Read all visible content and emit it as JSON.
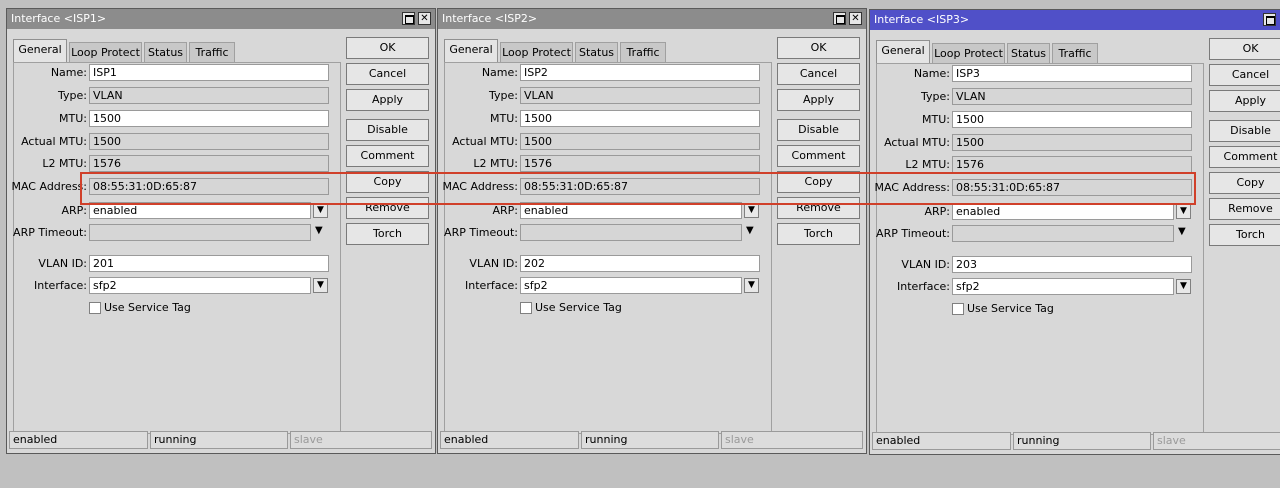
{
  "windows": [
    {
      "title": "Interface <ISP1>",
      "tabs": [
        "General",
        "Loop Protect",
        "Status",
        "Traffic"
      ],
      "labels": {
        "name": "Name:",
        "type": "Type:",
        "mtu": "MTU:",
        "actual_mtu": "Actual MTU:",
        "l2_mtu": "L2 MTU:",
        "mac": "MAC Address:",
        "arp": "ARP:",
        "arp_timeout": "ARP Timeout:",
        "vlan_id": "VLAN ID:",
        "interface": "Interface:"
      },
      "fields": {
        "name": "ISP1",
        "type": "VLAN",
        "mtu": "1500",
        "actual_mtu": "1500",
        "l2_mtu": "1576",
        "mac": "08:55:31:0D:65:87",
        "arp": "enabled",
        "arp_timeout": "",
        "vlan_id": "201",
        "interface": "sfp2"
      },
      "use_service_tag": "Use Service Tag",
      "buttons": [
        "OK",
        "Cancel",
        "Apply",
        "Disable",
        "Comment",
        "Copy",
        "Remove",
        "Torch"
      ],
      "status": [
        "enabled",
        "running",
        "slave"
      ]
    },
    {
      "title": "Interface <ISP2>",
      "tabs": [
        "General",
        "Loop Protect",
        "Status",
        "Traffic"
      ],
      "labels": {
        "name": "Name:",
        "type": "Type:",
        "mtu": "MTU:",
        "actual_mtu": "Actual MTU:",
        "l2_mtu": "L2 MTU:",
        "mac": "MAC Address:",
        "arp": "ARP:",
        "arp_timeout": "ARP Timeout:",
        "vlan_id": "VLAN ID:",
        "interface": "Interface:"
      },
      "fields": {
        "name": "ISP2",
        "type": "VLAN",
        "mtu": "1500",
        "actual_mtu": "1500",
        "l2_mtu": "1576",
        "mac": "08:55:31:0D:65:87",
        "arp": "enabled",
        "arp_timeout": "",
        "vlan_id": "202",
        "interface": "sfp2"
      },
      "use_service_tag": "Use Service Tag",
      "buttons": [
        "OK",
        "Cancel",
        "Apply",
        "Disable",
        "Comment",
        "Copy",
        "Remove",
        "Torch"
      ],
      "status": [
        "enabled",
        "running",
        "slave"
      ]
    },
    {
      "title": "Interface <ISP3>",
      "tabs": [
        "General",
        "Loop Protect",
        "Status",
        "Traffic"
      ],
      "labels": {
        "name": "Name:",
        "type": "Type:",
        "mtu": "MTU:",
        "actual_mtu": "Actual MTU:",
        "l2_mtu": "L2 MTU:",
        "mac": "MAC Address:",
        "arp": "ARP:",
        "arp_timeout": "ARP Timeout:",
        "vlan_id": "VLAN ID:",
        "interface": "Interface:"
      },
      "fields": {
        "name": "ISP3",
        "type": "VLAN",
        "mtu": "1500",
        "actual_mtu": "1500",
        "l2_mtu": "1576",
        "mac": "08:55:31:0D:65:87",
        "arp": "enabled",
        "arp_timeout": "",
        "vlan_id": "203",
        "interface": "sfp2"
      },
      "use_service_tag": "Use Service Tag",
      "buttons": [
        "OK",
        "Cancel",
        "Apply",
        "Disable",
        "Comment",
        "Copy",
        "Remove",
        "Torch"
      ],
      "status": [
        "enabled",
        "running",
        "slave"
      ]
    }
  ],
  "colors": {
    "active_title": "#5050c8",
    "inactive_title": "#8c8c8c",
    "highlight": "#d0402a"
  }
}
